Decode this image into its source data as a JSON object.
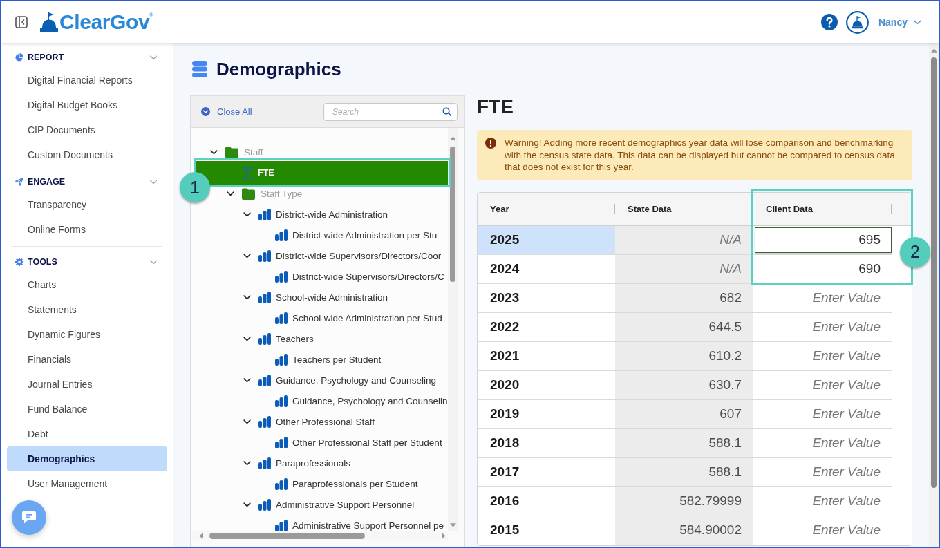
{
  "header": {
    "logo": "ClearGov$^{®}$",
    "user_name": "Nancy"
  },
  "sidebar": {
    "groups": [
      {
        "sections": [
          {
            "title": "REPORT",
            "expanded": true,
            "items": [
              {
                "label": "Digital Financial Reports",
                "selected": false
              },
              {
                "label": "Digital Budget Books",
                "selected": false
              },
              {
                "label": "CIP Documents",
                "selected": false
              },
              {
                "label": "Custom Documents",
                "selected": false
              }
            ]
          },
          {
            "title": "ENGAGE",
            "expanded": true,
            "items": [
              {
                "label": "Transparency",
                "selected": false
              },
              {
                "label": "Online Forms",
                "selected": false
              }
            ]
          }
        ]
      },
      {
        "sections": [
          {
            "title": "TOOLS",
            "expanded": true,
            "items": [
              {
                "label": "Charts",
                "selected": false
              },
              {
                "label": "Statements",
                "selected": false
              },
              {
                "label": "Dynamic Figures",
                "selected": false
              },
              {
                "label": "Financials",
                "selected": false
              },
              {
                "label": "Journal Entries",
                "selected": false
              },
              {
                "label": "Fund Balance",
                "selected": false
              },
              {
                "label": "Debt",
                "selected": false
              },
              {
                "label": "Demographics",
                "selected": true
              },
              {
                "label": "User Management",
                "selected": false
              }
            ]
          }
        ]
      }
    ]
  },
  "page": {
    "title": "Demographics"
  },
  "tree_panel": {
    "close_all": "Close All",
    "search": {
      "placeholder": "Search"
    },
    "callout": "1",
    "tree": [
      {
        "label": "Staff",
        "kind": "folder",
        "expanded": true,
        "selected": false,
        "children": [
          {
            "label": "FTE",
            "kind": "total",
            "selected": true
          },
          {
            "label": "Staff Type",
            "kind": "folder",
            "expanded": true,
            "selected": false,
            "children": [
              {
                "label": "District-wide Administration",
                "kind": "metric",
                "expanded": true,
                "selected": false,
                "children": [
                  {
                    "label": "District-wide Administration per Stu",
                    "kind": "metric",
                    "selected": false
                  }
                ]
              },
              {
                "label": "District-wide Supervisors/Directors/Coor",
                "kind": "metric",
                "expanded": true,
                "selected": false,
                "children": [
                  {
                    "label": "District-wide Supervisors/Directors/C",
                    "kind": "metric",
                    "selected": false
                  }
                ]
              },
              {
                "label": "School-wide Administration",
                "kind": "metric",
                "expanded": true,
                "selected": false,
                "children": [
                  {
                    "label": "School-wide Administration per Stud",
                    "kind": "metric",
                    "selected": false
                  }
                ]
              },
              {
                "label": "Teachers",
                "kind": "metric",
                "expanded": true,
                "selected": false,
                "children": [
                  {
                    "label": "Teachers per Student",
                    "kind": "metric",
                    "selected": false
                  }
                ]
              },
              {
                "label": "Guidance, Psychology and Counseling",
                "kind": "metric",
                "expanded": true,
                "selected": false,
                "children": [
                  {
                    "label": "Guidance, Psychology and Counselin",
                    "kind": "metric",
                    "selected": false
                  }
                ]
              },
              {
                "label": "Other Professional Staff",
                "kind": "metric",
                "expanded": true,
                "selected": false,
                "children": [
                  {
                    "label": "Other Professional Staff per Student",
                    "kind": "metric",
                    "selected": false
                  }
                ]
              },
              {
                "label": "Paraprofessionals",
                "kind": "metric",
                "expanded": true,
                "selected": false,
                "children": [
                  {
                    "label": "Paraprofessionals per Student",
                    "kind": "metric",
                    "selected": false
                  }
                ]
              },
              {
                "label": "Administrative Support Personnel",
                "kind": "metric",
                "expanded": true,
                "selected": false,
                "children": [
                  {
                    "label": "Administrative Support Personnel pe",
                    "kind": "metric",
                    "selected": false
                  }
                ]
              }
            ]
          }
        ]
      }
    ]
  },
  "detail": {
    "title": "FTE",
    "warning": "Warning! Adding more recent demographics year data will lose comparison and benchmarking with the census state data. This data can be displayed but cannot be compared to census data that does not exist for this year.",
    "table": {
      "columns": [
        "Year",
        "State Data",
        "Client Data"
      ],
      "callout": "2",
      "rows": [
        {
          "year": "2025",
          "selected": true,
          "state_data": "N/A",
          "state_missing": true,
          "client_data": {
            "value": "695",
            "editing": true
          }
        },
        {
          "year": "2024",
          "selected": false,
          "state_data": "N/A",
          "state_missing": true,
          "client_data": {
            "value": "690",
            "editing": false
          }
        },
        {
          "year": "2023",
          "selected": false,
          "state_data": "682",
          "state_missing": false,
          "client_data": {
            "placeholder": "Enter Value",
            "editing": false
          }
        },
        {
          "year": "2022",
          "selected": false,
          "state_data": "644.5",
          "state_missing": false,
          "client_data": {
            "placeholder": "Enter Value",
            "editing": false
          }
        },
        {
          "year": "2021",
          "selected": false,
          "state_data": "610.2",
          "state_missing": false,
          "client_data": {
            "placeholder": "Enter Value",
            "editing": false
          }
        },
        {
          "year": "2020",
          "selected": false,
          "state_data": "630.7",
          "state_missing": false,
          "client_data": {
            "placeholder": "Enter Value",
            "editing": false
          }
        },
        {
          "year": "2019",
          "selected": false,
          "state_data": "607",
          "state_missing": false,
          "client_data": {
            "placeholder": "Enter Value",
            "editing": false
          }
        },
        {
          "year": "2018",
          "selected": false,
          "state_data": "588.1",
          "state_missing": false,
          "client_data": {
            "placeholder": "Enter Value",
            "editing": false
          }
        },
        {
          "year": "2017",
          "selected": false,
          "state_data": "588.1",
          "state_missing": false,
          "client_data": {
            "placeholder": "Enter Value",
            "editing": false
          }
        },
        {
          "year": "2016",
          "selected": false,
          "state_data": "582.79999",
          "state_missing": false,
          "client_data": {
            "placeholder": "Enter Value",
            "editing": false
          }
        },
        {
          "year": "2015",
          "selected": false,
          "state_data": "584.90002",
          "state_missing": false,
          "client_data": {
            "placeholder": "Enter Value",
            "editing": false
          }
        }
      ]
    }
  }
}
